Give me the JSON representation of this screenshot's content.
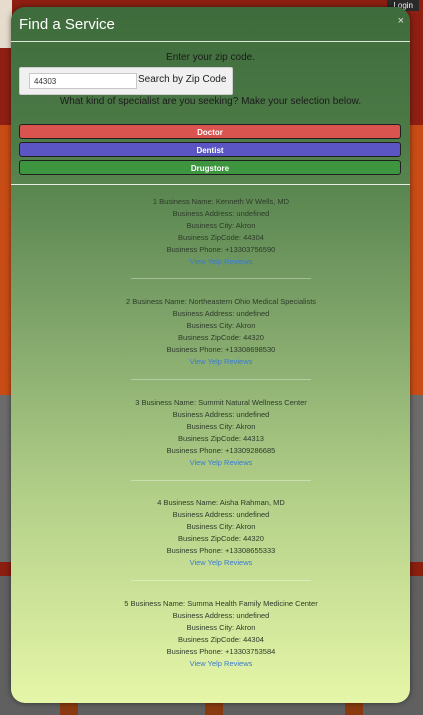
{
  "background": {
    "login_label": "Login"
  },
  "modal": {
    "title": "Find a Service",
    "close_label": "×",
    "zip_prompt": "Enter your zip code.",
    "zip_value": "44303",
    "zip_button": "Search by Zip Code",
    "specialist_prompt": "What kind of specialist are you seeking? Make your selection below.",
    "buttons": {
      "doctor": "Doctor",
      "dentist": "Dentist",
      "drugstore": "Drugstore"
    },
    "colors": {
      "doctor": "#d9534f",
      "dentist": "#5a55c2",
      "drugstore": "#3e9540"
    }
  },
  "results": [
    {
      "name": "1 Business Name: Kenneth W Wells, MD",
      "address": "Business Address: undefined",
      "city": "Business City: Akron",
      "zip": "Business ZipCode: 44304",
      "phone": "Business Phone: +13303756590",
      "link": "View Yelp Reviews"
    },
    {
      "name": "2 Business Name: Northeastern Ohio Medical Specialists",
      "address": "Business Address: undefined",
      "city": "Business City: Akron",
      "zip": "Business ZipCode: 44320",
      "phone": "Business Phone: +13308698530",
      "link": "View Yelp Reviews"
    },
    {
      "name": "3 Business Name: Summit Natural Wellness Center",
      "address": "Business Address: undefined",
      "city": "Business City: Akron",
      "zip": "Business ZipCode: 44313",
      "phone": "Business Phone: +13309286685",
      "link": "View Yelp Reviews"
    },
    {
      "name": "4 Business Name: Aisha Rahman, MD",
      "address": "Business Address: undefined",
      "city": "Business City: Akron",
      "zip": "Business ZipCode: 44320",
      "phone": "Business Phone: +13308655333",
      "link": "View Yelp Reviews"
    },
    {
      "name": "5 Business Name: Summa Health Family Medicine Center",
      "address": "Business Address: undefined",
      "city": "Business City: Akron",
      "zip": "Business ZipCode: 44304",
      "phone": "Business Phone: +13303753584",
      "link": "View Yelp Reviews"
    }
  ]
}
